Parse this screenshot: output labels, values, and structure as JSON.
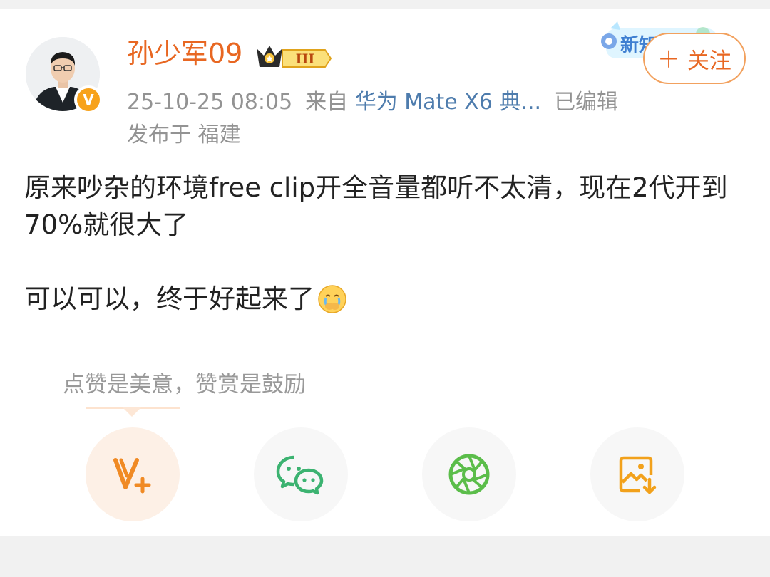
{
  "post": {
    "author": {
      "name": "孙少军09",
      "level_badge": "III",
      "verified_mark": "V"
    },
    "follow_label": "关注",
    "banner_text": "新知",
    "meta": {
      "timestamp": "25-10-25 08:05",
      "from_prefix": "来自",
      "source": "华为 Mate X6 典...",
      "edited": "已编辑"
    },
    "location": "发布于 福建",
    "content": {
      "paragraph_1": "原来吵杂的环境free clip开全音量都听不太清，现在2代开到70%就很大了",
      "paragraph_2": "可以可以，终于好起来了"
    },
    "reward_hint": "点赞是美意，赞赏是鼓励",
    "actions": [
      {
        "name": "reward",
        "icon": "v-plus-icon",
        "color": "#f08a24"
      },
      {
        "name": "wechat",
        "icon": "wechat-icon",
        "color": "#3cb371"
      },
      {
        "name": "moments",
        "icon": "wechat-moments-icon",
        "color": "#5bbd4a"
      },
      {
        "name": "save-image",
        "icon": "save-image-icon",
        "color": "#f2a11b"
      }
    ]
  }
}
